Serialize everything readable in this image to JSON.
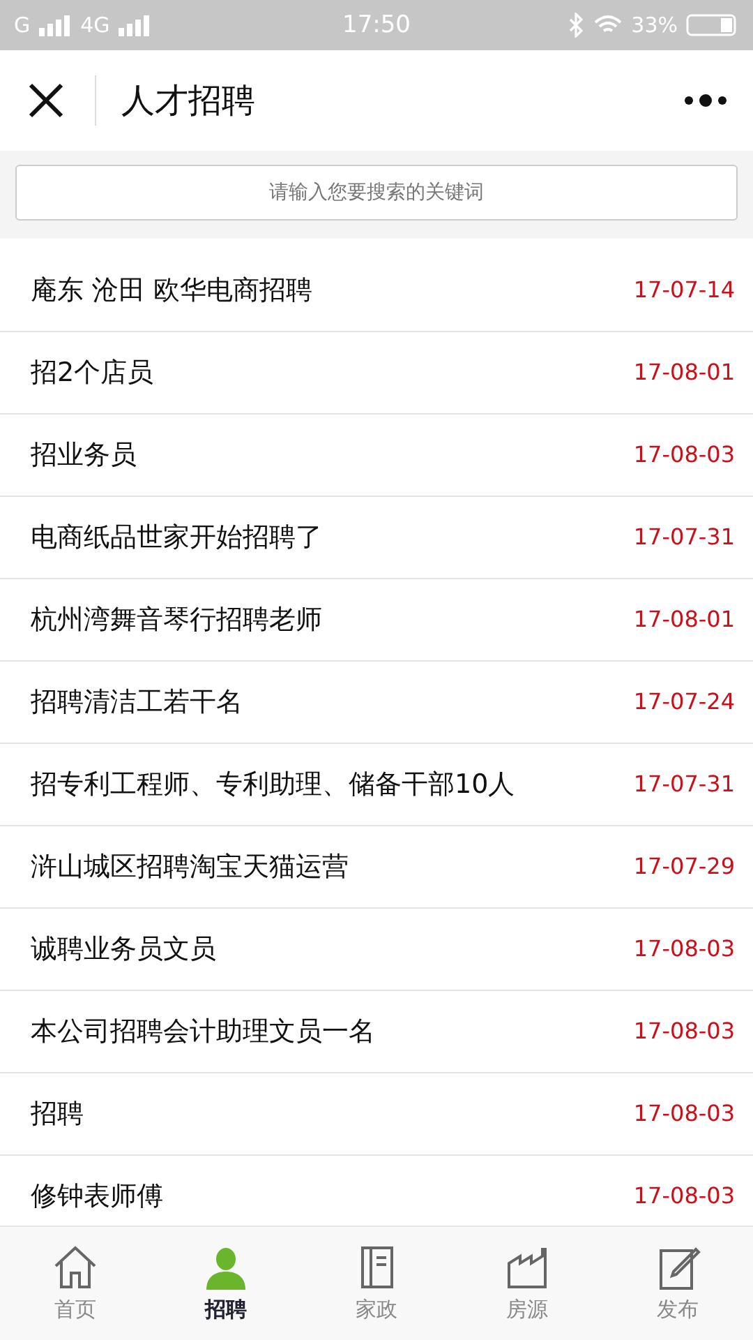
{
  "status_bar": {
    "carrier_1": "G",
    "carrier_2": "4G",
    "time": "17:50",
    "battery": "33%"
  },
  "header": {
    "title": "人才招聘"
  },
  "search": {
    "placeholder": "请输入您要搜索的关键词"
  },
  "jobs": [
    {
      "title": "庵东 沧田 欧华电商招聘",
      "date": "17-07-14"
    },
    {
      "title": "招2个店员",
      "date": "17-08-01"
    },
    {
      "title": "招业务员",
      "date": "17-08-03"
    },
    {
      "title": "电商纸品世家开始招聘了",
      "date": "17-07-31"
    },
    {
      "title": "杭州湾舞音琴行招聘老师",
      "date": "17-08-01"
    },
    {
      "title": "招聘清洁工若干名",
      "date": "17-07-24"
    },
    {
      "title": "招专利工程师、专利助理、储备干部10人",
      "date": "17-07-31"
    },
    {
      "title": "浒山城区招聘淘宝天猫运营",
      "date": "17-07-29"
    },
    {
      "title": "诚聘业务员文员",
      "date": "17-08-03"
    },
    {
      "title": "本公司招聘会计助理文员一名",
      "date": "17-08-03"
    },
    {
      "title": "招聘",
      "date": "17-08-03"
    },
    {
      "title": "修钟表师傅",
      "date": "17-08-03"
    }
  ],
  "tab_bar": [
    {
      "kind": "home",
      "label": "首页",
      "selected": false
    },
    {
      "kind": "person",
      "label": "招聘",
      "selected": true
    },
    {
      "kind": "book",
      "label": "家政",
      "selected": false
    },
    {
      "kind": "building",
      "label": "房源",
      "selected": false
    },
    {
      "kind": "edit",
      "label": "发布",
      "selected": false
    }
  ]
}
